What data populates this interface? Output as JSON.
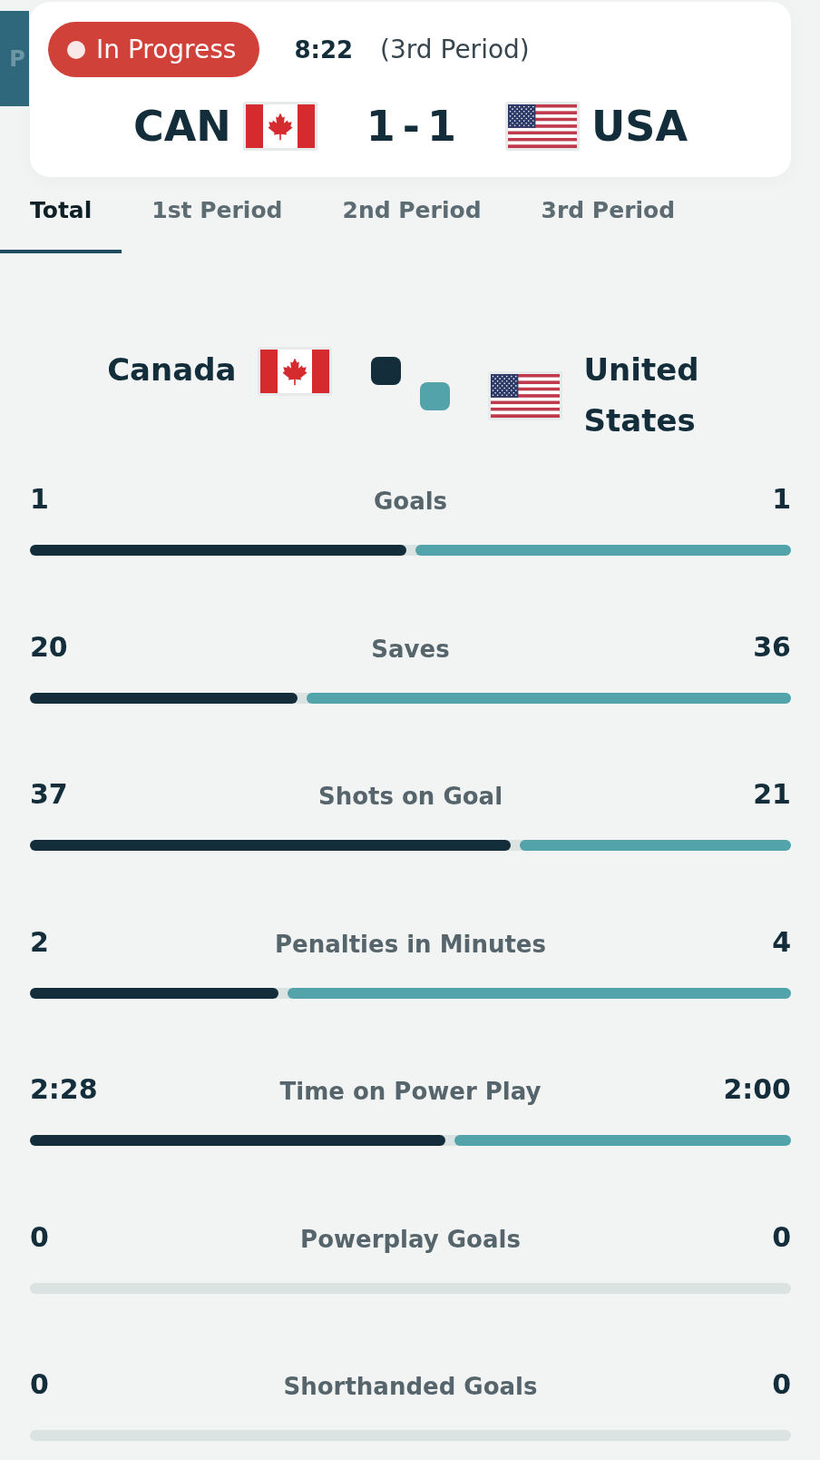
{
  "side_tab": {
    "label": "P"
  },
  "match": {
    "status": "In Progress",
    "clock": "8:22",
    "period": "(3rd Period)",
    "home_code": "CAN",
    "score": "1 - 1",
    "away_code": "USA"
  },
  "tabs": [
    {
      "label": "Total",
      "selected": true
    },
    {
      "label": "1st Period",
      "selected": false
    },
    {
      "label": "2nd Period",
      "selected": false
    },
    {
      "label": "3rd Period",
      "selected": false
    }
  ],
  "teams": [
    {
      "name": "Canada",
      "color": "#132e3a"
    },
    {
      "name": "United States",
      "color": "#53a3aa"
    }
  ],
  "stats": [
    {
      "label": "Goals",
      "home": "1",
      "away": "1",
      "home_bar": {
        "level": 0.5
      },
      "away_bar": {
        "level": 0.5
      }
    },
    {
      "label": "Saves",
      "home": "20",
      "away": "36",
      "home_bar": {
        "level": 0.357
      },
      "away_bar": {
        "level": 0.643
      }
    },
    {
      "label": "Shots on Goal",
      "home": "37",
      "away": "21",
      "home_bar": {
        "level": 0.638
      },
      "away_bar": {
        "level": 0.362
      }
    },
    {
      "label": "Penalties in Minutes",
      "home": "2",
      "away": "4",
      "home_bar": {
        "level": 0.333
      },
      "away_bar": {
        "level": 0.667
      }
    },
    {
      "label": "Time on Power Play",
      "home": "2:28",
      "away": "2:00",
      "home_bar": {
        "level": 0.552
      },
      "away_bar": {
        "level": 0.448
      }
    },
    {
      "label": "Powerplay Goals",
      "home": "0",
      "away": "0"
    },
    {
      "label": "Shorthanded Goals",
      "home": "0",
      "away": "0"
    }
  ]
}
